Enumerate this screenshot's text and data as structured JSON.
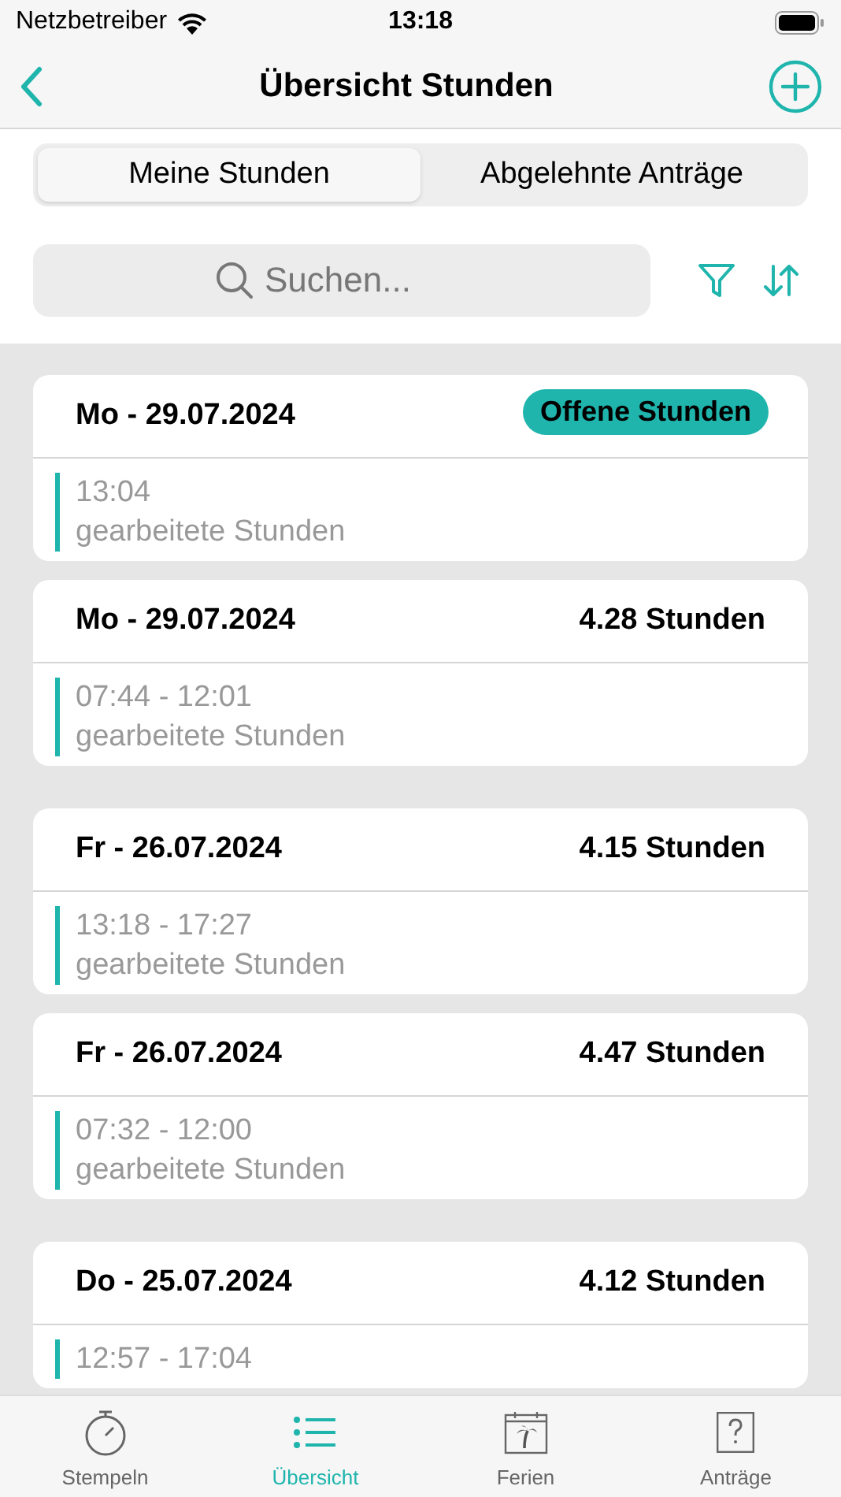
{
  "status_bar": {
    "carrier": "Netzbetreiber",
    "time": "13:18"
  },
  "nav": {
    "title": "Übersicht Stunden"
  },
  "segments": [
    {
      "label": "Meine Stunden",
      "selected": true
    },
    {
      "label": "Abgelehnte Anträge",
      "selected": false
    }
  ],
  "search": {
    "placeholder": "Suchen..."
  },
  "groups": [
    {
      "entries": [
        {
          "date": "Mo - 29.07.2024",
          "summary": {
            "kind": "badge",
            "text": "Offene Stunden"
          },
          "time": "13:04",
          "label": "gearbeitete Stunden"
        },
        {
          "date": "Mo - 29.07.2024",
          "summary": {
            "kind": "hours",
            "text": "4.28 Stunden"
          },
          "time": "07:44 - 12:01",
          "label": "gearbeitete Stunden"
        }
      ]
    },
    {
      "entries": [
        {
          "date": "Fr - 26.07.2024",
          "summary": {
            "kind": "hours",
            "text": "4.15 Stunden"
          },
          "time": "13:18 - 17:27",
          "label": "gearbeitete Stunden"
        },
        {
          "date": "Fr - 26.07.2024",
          "summary": {
            "kind": "hours",
            "text": "4.47 Stunden"
          },
          "time": "07:32 - 12:00",
          "label": "gearbeitete Stunden"
        }
      ]
    },
    {
      "entries": [
        {
          "date": "Do - 25.07.2024",
          "summary": {
            "kind": "hours",
            "text": "4.12 Stunden"
          },
          "time": "12:57 - 17:04"
        }
      ]
    }
  ],
  "tab_bar": [
    {
      "kind": "stopwatch",
      "label": "Stempeln",
      "selected": false
    },
    {
      "kind": "list",
      "label": "Übersicht",
      "selected": true
    },
    {
      "kind": "holiday",
      "label": "Ferien",
      "selected": false
    },
    {
      "kind": "question",
      "label": "Anträge",
      "selected": false
    }
  ]
}
